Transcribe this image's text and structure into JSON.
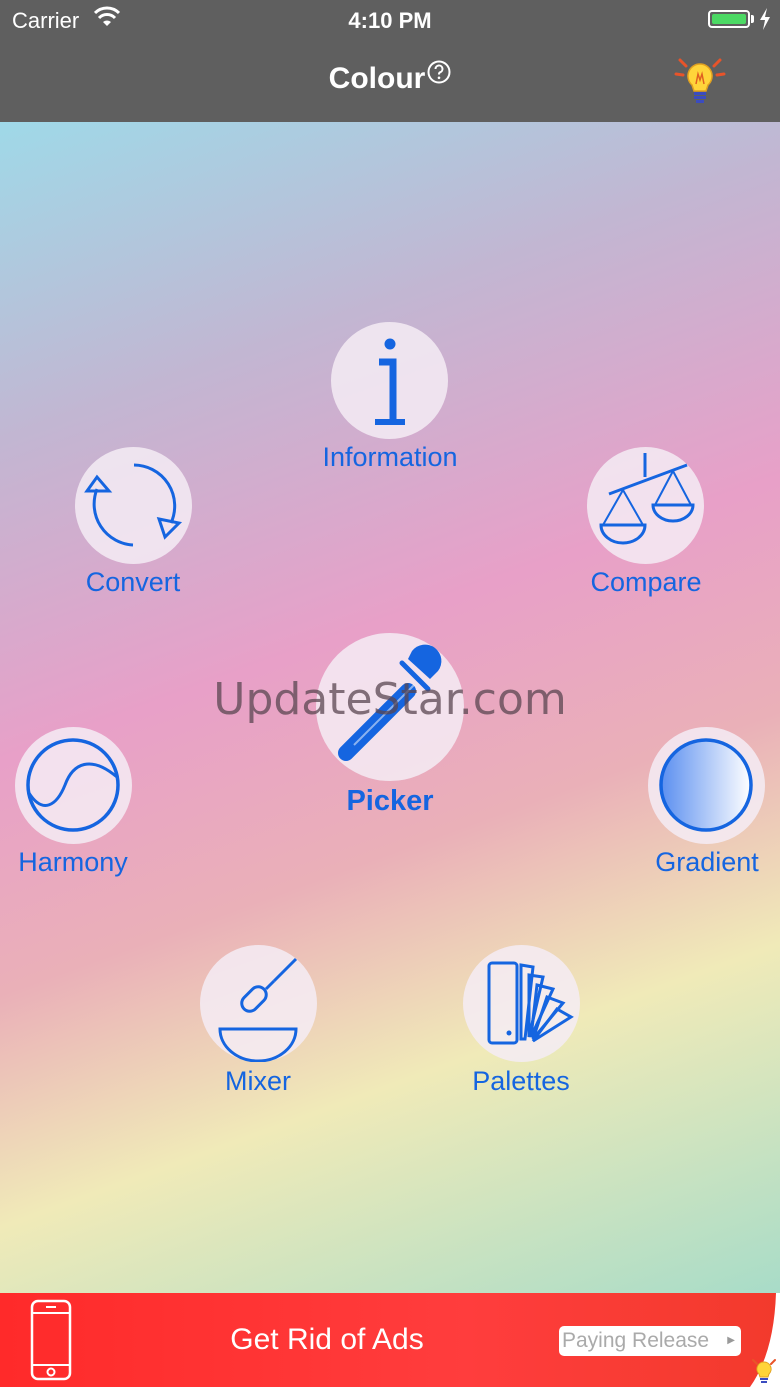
{
  "status_bar": {
    "carrier": "Carrier",
    "time": "4:10 PM"
  },
  "nav": {
    "title": "Colour",
    "help_icon": "question-circle-icon",
    "right_icon": "lightbulb-icon"
  },
  "menu": {
    "information": "Information",
    "convert": "Convert",
    "compare": "Compare",
    "picker": "Picker",
    "harmony": "Harmony",
    "gradient": "Gradient",
    "mixer": "Mixer",
    "palettes": "Palettes"
  },
  "watermark": "UpdateStar.com",
  "ad": {
    "text": "Get Rid of Ads",
    "button": "Paying Release"
  },
  "colors": {
    "accent": "#1565e0",
    "nav_bg": "#5f5f5f",
    "ad_bg": "#ff2a2a",
    "battery": "#4cd964"
  }
}
